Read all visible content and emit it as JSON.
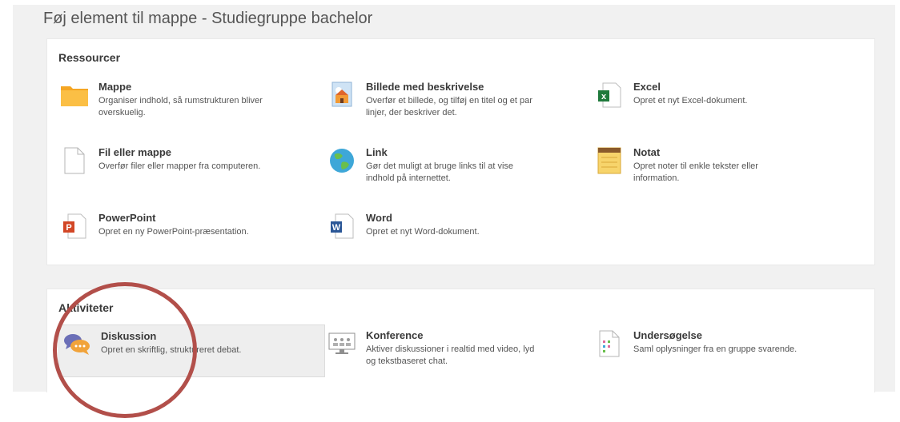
{
  "dialog": {
    "title": "Føj element til mappe - Studiegruppe bachelor"
  },
  "resources": {
    "heading": "Ressourcer",
    "items": [
      {
        "icon": "folder-icon",
        "name": "Mappe",
        "desc1": "Organiser indhold, så rumstrukturen bliver",
        "desc2": "overskuelig."
      },
      {
        "icon": "image-icon",
        "name": "Billede med beskrivelse",
        "desc1": "Overfør et billede, og tilføj en titel og et par",
        "desc2": "linjer, der beskriver det."
      },
      {
        "icon": "excel-icon",
        "name": "Excel",
        "desc1": "Opret et nyt Excel-dokument.",
        "desc2": ""
      },
      {
        "icon": "file-icon",
        "name": "Fil eller mappe",
        "desc1": "Overfør filer eller mapper fra computeren.",
        "desc2": ""
      },
      {
        "icon": "globe-icon",
        "name": "Link",
        "desc1": "Gør det muligt at bruge links til at vise",
        "desc2": "indhold på internettet."
      },
      {
        "icon": "note-icon",
        "name": "Notat",
        "desc1": "Opret noter til enkle tekster eller",
        "desc2": "information."
      },
      {
        "icon": "powerpoint-icon",
        "name": "PowerPoint",
        "desc1": "Opret en ny PowerPoint-præsentation.",
        "desc2": ""
      },
      {
        "icon": "word-icon",
        "name": "Word",
        "desc1": "Opret et nyt Word-dokument.",
        "desc2": ""
      }
    ]
  },
  "activities": {
    "heading": "Aktiviteter",
    "items": [
      {
        "icon": "discussion-icon",
        "name": "Diskussion",
        "desc1": "Opret en skriftlig, struktureret debat.",
        "desc2": ""
      },
      {
        "icon": "conference-icon",
        "name": "Konference",
        "desc1": "Aktiver diskussioner i realtid med video, lyd",
        "desc2": "og tekstbaseret chat."
      },
      {
        "icon": "survey-icon",
        "name": "Undersøgelse",
        "desc1": "Saml oplysninger fra en gruppe svarende.",
        "desc2": ""
      }
    ]
  },
  "colors": {
    "annotation_circle": "#b24f4a",
    "panel_bg": "#f1f1f1",
    "selected_bg": "#eeeeee"
  }
}
